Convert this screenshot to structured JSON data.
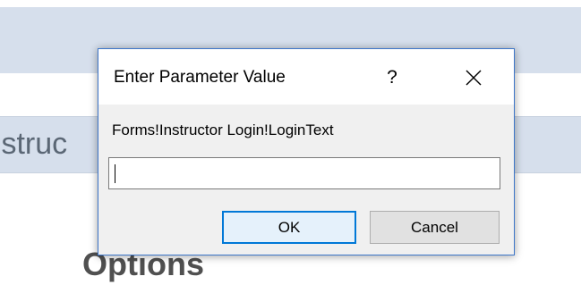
{
  "background": {
    "form_title_fragment": "ıstruc",
    "options_heading_fragment": "Options"
  },
  "dialog": {
    "title": "Enter Parameter Value",
    "help_label": "?",
    "prompt": "Forms!Instructor Login!LoginText",
    "input": {
      "value": "",
      "placeholder": ""
    },
    "buttons": {
      "ok_label": "OK",
      "cancel_label": "Cancel"
    },
    "icons": {
      "close": "close-icon"
    }
  },
  "colors": {
    "background_band": "#d6dfec",
    "dialog_border": "#3d76c9",
    "dialog_body": "#f0f0f0",
    "default_button_border": "#0078d7",
    "button_face": "#e1e1e1"
  }
}
